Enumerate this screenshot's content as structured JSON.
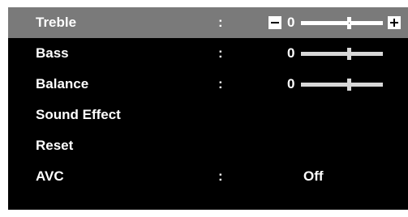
{
  "menu": {
    "items": [
      {
        "label": "Treble",
        "colon": ":",
        "value": "0",
        "level": 0.5,
        "selected": true
      },
      {
        "label": "Bass",
        "colon": ":",
        "value": "0",
        "level": 0.5,
        "selected": false
      },
      {
        "label": "Balance",
        "colon": ":",
        "value": "0",
        "level": 0.5,
        "selected": false
      },
      {
        "label": "Sound Effect"
      },
      {
        "label": "Reset"
      },
      {
        "label": "AVC",
        "colon": ":",
        "value": "Off"
      }
    ]
  },
  "icons": {
    "decrease": "minus-icon",
    "increase": "plus-icon"
  },
  "colors": {
    "background": "#000000",
    "selected_row": "#7a7a7a",
    "text": "#ffffff",
    "slider": "#d8d8d8"
  }
}
